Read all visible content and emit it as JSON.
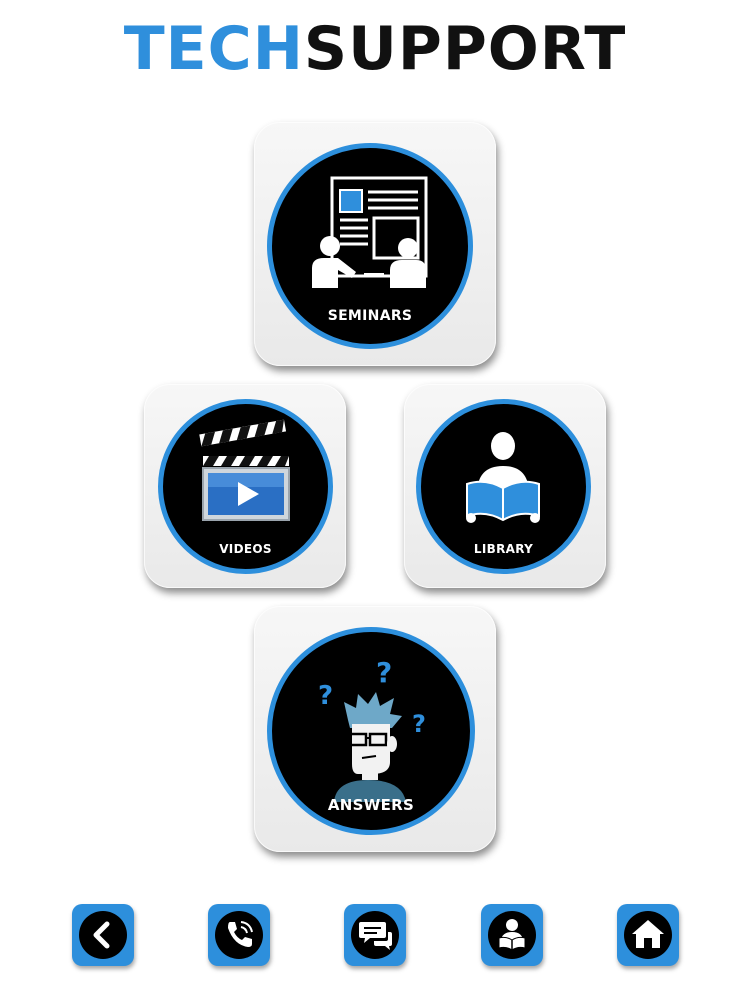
{
  "header": {
    "logo_part1": "TECH",
    "logo_part2": "SUPPORT"
  },
  "tiles": {
    "seminars": {
      "label": "SEMINARS",
      "icon": "seminar-presentation-icon"
    },
    "videos": {
      "label": "VIDEOS",
      "icon": "clapperboard-video-icon"
    },
    "library": {
      "label": "LIBRARY",
      "icon": "person-reading-book-icon"
    },
    "answers": {
      "label": "ANSWERS",
      "icon": "confused-person-question-icon"
    }
  },
  "nav": [
    {
      "icon": "back-chevron-icon"
    },
    {
      "icon": "phone-call-icon"
    },
    {
      "icon": "chat-bubbles-icon"
    },
    {
      "icon": "reader-person-icon"
    },
    {
      "icon": "home-icon"
    }
  ],
  "colors": {
    "accent": "#2d8fdc",
    "logo_blue": "#2f8fdc",
    "logo_dark": "#111111",
    "circle_bg": "#000000"
  }
}
